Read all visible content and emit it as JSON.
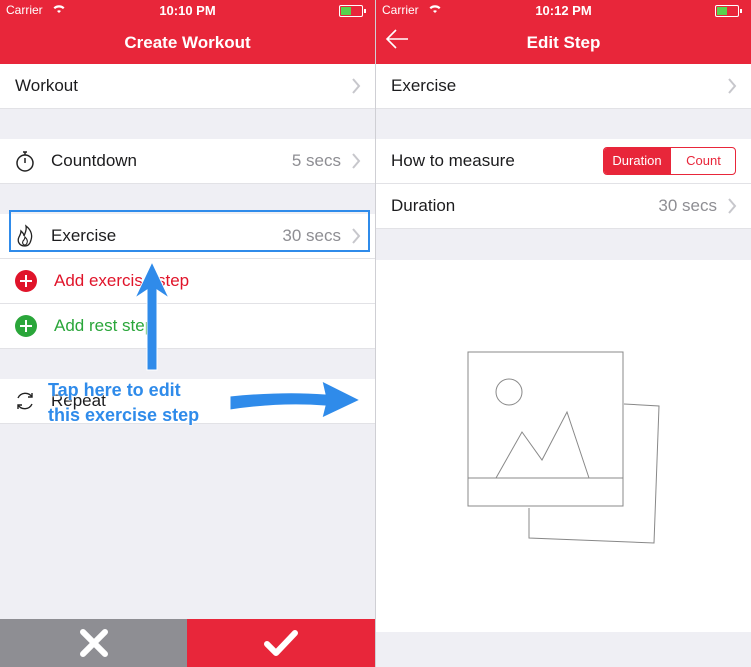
{
  "left": {
    "status": {
      "carrier": "Carrier",
      "time": "10:10 PM"
    },
    "title": "Create Workout",
    "rows": {
      "workout": {
        "label": "Workout"
      },
      "countdown": {
        "label": "Countdown",
        "value": "5 secs"
      },
      "exercise": {
        "label": "Exercise",
        "value": "30 secs"
      },
      "add_exercise": {
        "label": "Add exercise step"
      },
      "add_rest": {
        "label": "Add rest step"
      },
      "repeat": {
        "label": "Repeat"
      }
    },
    "footer": {
      "cancel_icon": "close-icon",
      "confirm_icon": "checkmark-icon"
    }
  },
  "right": {
    "status": {
      "carrier": "Carrier",
      "time": "10:12 PM"
    },
    "title": "Edit Step",
    "rows": {
      "exercise": {
        "label": "Exercise"
      },
      "measure": {
        "label": "How to measure",
        "options": [
          "Duration",
          "Count"
        ],
        "selected": "Duration"
      },
      "duration": {
        "label": "Duration",
        "value": "30 secs"
      }
    },
    "image_placeholder_icon": "image-placeholder-icon"
  },
  "annotation": {
    "line1": "Tap here to edit",
    "line2": "this exercise step"
  },
  "colors": {
    "brand_red": "#e8263a",
    "add_exercise_red": "#e0142a",
    "add_rest_green": "#2aa63a",
    "highlight_blue": "#2f8bea",
    "cancel_gray": "#8e8e93"
  }
}
